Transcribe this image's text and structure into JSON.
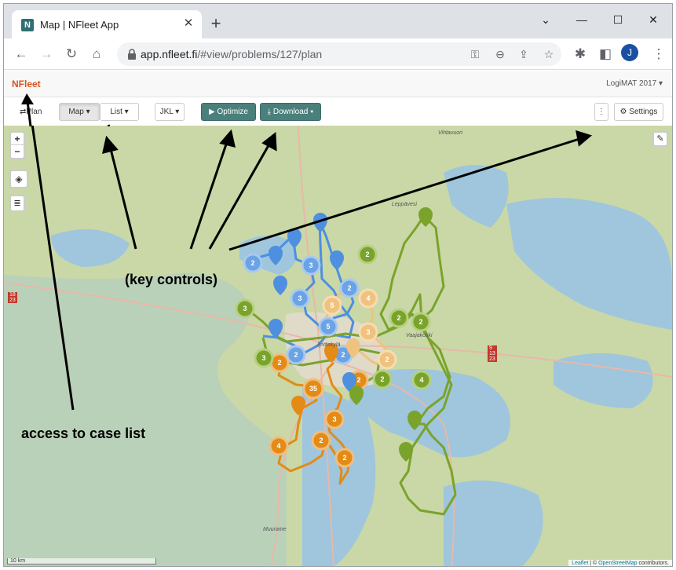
{
  "browser": {
    "tab_title": "Map | NFleet App",
    "favicon_letter": "N",
    "url_host": "app.nfleet.fi",
    "url_path": "/#view/problems/127/plan",
    "avatar_letter": "J"
  },
  "app": {
    "brand": "NFleet",
    "account": "LogiMAT 2017 ▾"
  },
  "controls": {
    "plan_label": "Plan",
    "map_label": "Map ▾",
    "list_label": "List ▾",
    "depot_label": "JKL ▾",
    "optimize_label": "▶  Optimize",
    "download_label": "⤓ Download ▾",
    "more_label": "⋮",
    "settings_label": "⚙ Settings"
  },
  "map": {
    "zoom_in": "+",
    "zoom_out": "−",
    "scale": "10 km",
    "attribution_leaflet": "Leaflet",
    "attribution_osm": "OpenStreetMap",
    "attribution_rest": "contributors.",
    "place_labels": {
      "vihtavuori": "Vihtavuori",
      "leppavesi": "Leppävesi",
      "vaajakoski": "Vaajakoski",
      "jyvaskyla": "Jyväskylä",
      "muurame": "Muurame"
    },
    "road_numbers": {
      "r18": "18",
      "r23": "23",
      "r9": "9",
      "r13": "13",
      "r23b": "23"
    }
  },
  "annotations": {
    "key_controls": "(key controls)",
    "case_list": "access to case list"
  },
  "colors": {
    "blue_route": "#4e8fe0",
    "orange_route": "#e38b16",
    "light_orange_route": "#f0c27f",
    "green_route": "#7aa32b",
    "teal_button": "#4a7f7c",
    "brand": "#d9531e"
  }
}
